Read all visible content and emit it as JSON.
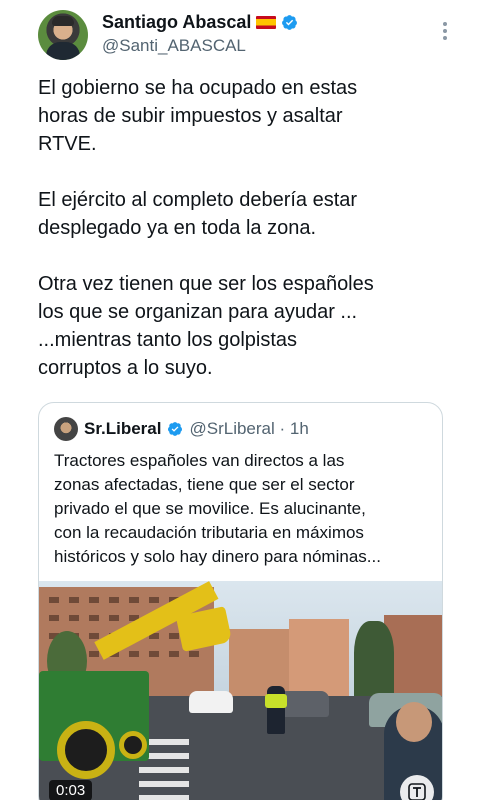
{
  "author": {
    "display_name": "Santiago Abascal",
    "flag_icon": "spain-flag-icon",
    "verified_icon": "verified-badge-icon",
    "handle": "@Santi_ABASCAL"
  },
  "more_icon": "more-vertical-icon",
  "tweet": {
    "text": "El gobierno se ha ocupado en estas\nhoras de subir impuestos y asaltar\nRTVE.\n\nEl ejército al completo debería estar\ndesplegado ya en toda la zona.\n\nOtra vez tienen que ser los españoles\nlos que se organizan para ayudar ...\n...mientras tanto los golpistas\ncorruptos a lo suyo."
  },
  "quoted_tweet": {
    "display_name": "Sr.Liberal",
    "verified_icon": "verified-badge-icon",
    "meta": "@SrLiberal · 1h",
    "text": "Tractores españoles van directos a las\nzonas afectadas, tiene que ser el sector\nprivado el que se movilice. Es alucinante,\ncon la recaudación tributaria en máximos\nhistóricos y solo hay dinero para nóminas...",
    "video_duration": "0:03",
    "translate_icon": "translate-icon"
  },
  "colors": {
    "text_primary": "#0f1419",
    "text_secondary": "#536471",
    "verified": "#1d9bf0",
    "border": "#cfd9de"
  }
}
